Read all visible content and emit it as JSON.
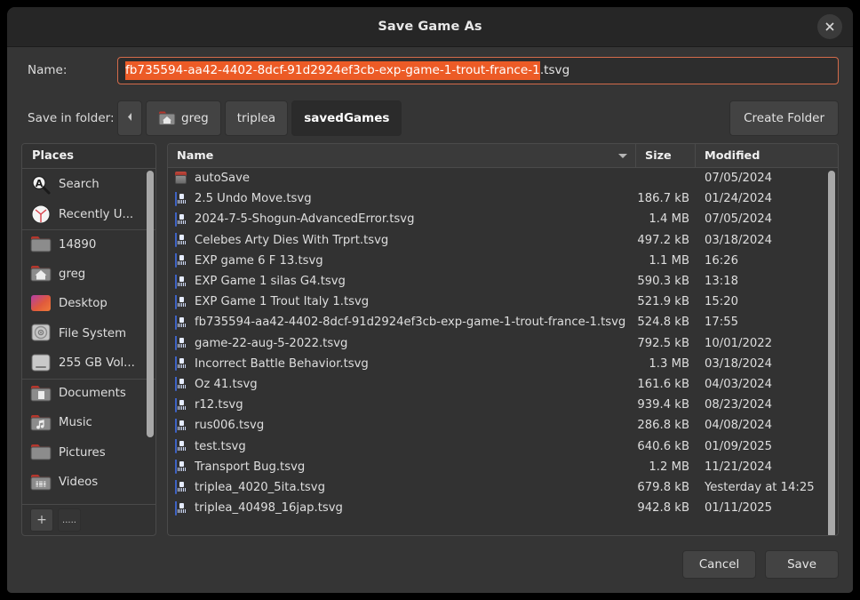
{
  "window": {
    "title": "Save Game As",
    "close_icon": "close-icon"
  },
  "name_field": {
    "label": "Name:",
    "selected_text": "fb735594-aa42-4402-8dcf-91d2924ef3cb-exp-game-1-trout-france-1",
    "unselected_text": ".tsvg",
    "full_value": "fb735594-aa42-4402-8dcf-91d2924ef3cb-exp-game-1-trout-france-1.tsvg",
    "selection_color": "#ec5b26",
    "border_color": "#d36b4a"
  },
  "location_bar": {
    "label": "Save in folder:",
    "back_icon": "chevron-left-icon",
    "crumbs": [
      {
        "label": "greg",
        "icon": "home-folder-icon",
        "current": false
      },
      {
        "label": "triplea",
        "icon": "",
        "current": false
      },
      {
        "label": "savedGames",
        "icon": "",
        "current": true
      }
    ],
    "create_folder_label": "Create Folder"
  },
  "sidebar": {
    "header": "Places",
    "items": [
      {
        "label": "Search",
        "icon": "search-icon",
        "separator": false
      },
      {
        "label": "Recently U...",
        "icon": "clock-icon",
        "separator": false
      },
      {
        "label": "14890",
        "icon": "folder-icon",
        "separator": true
      },
      {
        "label": "greg",
        "icon": "home-folder-icon",
        "separator": false
      },
      {
        "label": "Desktop",
        "icon": "desktop-icon",
        "separator": false
      },
      {
        "label": "File System",
        "icon": "disk-icon",
        "separator": false
      },
      {
        "label": "255 GB Vol...",
        "icon": "drive-icon",
        "separator": false
      },
      {
        "label": "Documents",
        "icon": "documents-folder-icon",
        "separator": true
      },
      {
        "label": "Music",
        "icon": "music-folder-icon",
        "separator": false
      },
      {
        "label": "Pictures",
        "icon": "pictures-folder-icon",
        "separator": false
      },
      {
        "label": "Videos",
        "icon": "videos-folder-icon",
        "separator": false
      }
    ],
    "add_button_label": "+",
    "more_button_label": "....."
  },
  "file_list": {
    "columns": {
      "name": "Name",
      "size": "Size",
      "modified": "Modified"
    },
    "sort_indicator": "chevron-down-icon",
    "rows": [
      {
        "name": "autoSave",
        "icon": "folder-icon",
        "size": "",
        "modified": "07/05/2024"
      },
      {
        "name": "2.5 Undo Move.tsvg",
        "icon": "file-icon",
        "size": "186.7 kB",
        "modified": "01/24/2024"
      },
      {
        "name": "2024-7-5-Shogun-AdvancedError.tsvg",
        "icon": "file-icon",
        "size": "1.4 MB",
        "modified": "07/05/2024"
      },
      {
        "name": "Celebes Arty Dies With Trprt.tsvg",
        "icon": "file-icon",
        "size": "497.2 kB",
        "modified": "03/18/2024"
      },
      {
        "name": "EXP game 6 F 13.tsvg",
        "icon": "file-icon",
        "size": "1.1 MB",
        "modified": "16:26"
      },
      {
        "name": "EXP Game 1 silas G4.tsvg",
        "icon": "file-icon",
        "size": "590.3 kB",
        "modified": "13:18"
      },
      {
        "name": "EXP Game 1 Trout Italy 1.tsvg",
        "icon": "file-icon",
        "size": "521.9 kB",
        "modified": "15:20"
      },
      {
        "name": "fb735594-aa42-4402-8dcf-91d2924ef3cb-exp-game-1-trout-france-1.tsvg",
        "icon": "file-icon",
        "size": "524.8 kB",
        "modified": "17:55"
      },
      {
        "name": "game-22-aug-5-2022.tsvg",
        "icon": "file-icon",
        "size": "792.5 kB",
        "modified": "10/01/2022"
      },
      {
        "name": "Incorrect Battle Behavior.tsvg",
        "icon": "file-icon",
        "size": "1.3 MB",
        "modified": "03/18/2024"
      },
      {
        "name": "Oz 41.tsvg",
        "icon": "file-icon",
        "size": "161.6 kB",
        "modified": "04/03/2024"
      },
      {
        "name": "r12.tsvg",
        "icon": "file-icon",
        "size": "939.4 kB",
        "modified": "08/23/2024"
      },
      {
        "name": "rus006.tsvg",
        "icon": "file-icon",
        "size": "286.8 kB",
        "modified": "04/08/2024"
      },
      {
        "name": "test.tsvg",
        "icon": "file-icon",
        "size": "640.6 kB",
        "modified": "01/09/2025"
      },
      {
        "name": "Transport Bug.tsvg",
        "icon": "file-icon",
        "size": "1.2 MB",
        "modified": "11/21/2024"
      },
      {
        "name": "triplea_4020_5ita.tsvg",
        "icon": "file-icon",
        "size": "679.8 kB",
        "modified": "Yesterday at 14:25"
      },
      {
        "name": "triplea_40498_16jap.tsvg",
        "icon": "file-icon",
        "size": "942.8 kB",
        "modified": "01/11/2025"
      }
    ]
  },
  "footer": {
    "cancel_label": "Cancel",
    "save_label": "Save"
  }
}
